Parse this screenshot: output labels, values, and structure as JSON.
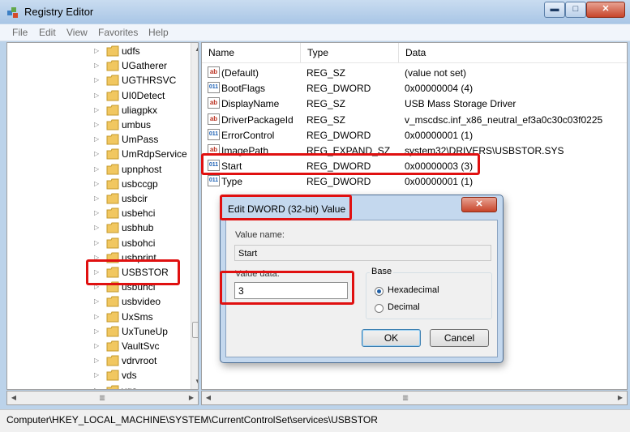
{
  "window": {
    "title": "Registry Editor",
    "minimize": "▬",
    "maximize": "□",
    "close": "✕"
  },
  "menu": [
    "File",
    "Edit",
    "View",
    "Favorites",
    "Help"
  ],
  "tree": {
    "items": [
      "udfs",
      "UGatherer",
      "UGTHRSVC",
      "UI0Detect",
      "uliagpkx",
      "umbus",
      "UmPass",
      "UmRdpService",
      "upnphost",
      "usbccgp",
      "usbcir",
      "usbehci",
      "usbhub",
      "usbohci",
      "usbprint",
      "USBSTOR",
      "usbuhci",
      "usbvideo",
      "UxSms",
      "UxTuneUp",
      "VaultSvc",
      "vdrvroot",
      "vds",
      "vga"
    ],
    "selected": "USBSTOR"
  },
  "list": {
    "columns": [
      "Name",
      "Type",
      "Data"
    ],
    "rows": [
      {
        "name": "(Default)",
        "type": "REG_SZ",
        "data": "(value not set)",
        "icon": "string-value-icon"
      },
      {
        "name": "BootFlags",
        "type": "REG_DWORD",
        "data": "0x00000004 (4)",
        "icon": "binary-value-icon"
      },
      {
        "name": "DisplayName",
        "type": "REG_SZ",
        "data": "USB Mass Storage Driver",
        "icon": "string-value-icon"
      },
      {
        "name": "DriverPackageId",
        "type": "REG_SZ",
        "data": "v_mscdsc.inf_x86_neutral_ef3a0c30c03f0225",
        "icon": "string-value-icon"
      },
      {
        "name": "ErrorControl",
        "type": "REG_DWORD",
        "data": "0x00000001 (1)",
        "icon": "binary-value-icon"
      },
      {
        "name": "ImagePath",
        "type": "REG_EXPAND_SZ",
        "data": "system32\\DRIVERS\\USBSTOR.SYS",
        "icon": "string-value-icon"
      },
      {
        "name": "Start",
        "type": "REG_DWORD",
        "data": "0x00000003 (3)",
        "icon": "binary-value-icon"
      },
      {
        "name": "Type",
        "type": "REG_DWORD",
        "data": "0x00000001 (1)",
        "icon": "binary-value-icon"
      }
    ]
  },
  "dialog": {
    "title": "Edit DWORD (32-bit) Value",
    "close": "✕",
    "value_name_label": "Value name:",
    "value_name": "Start",
    "value_data_label": "Value data:",
    "value_data": "3",
    "base_label": "Base",
    "base_options": [
      "Hexadecimal",
      "Decimal"
    ],
    "base_selected": "Hexadecimal",
    "ok": "OK",
    "cancel": "Cancel"
  },
  "status": {
    "path": "Computer\\HKEY_LOCAL_MACHINE\\SYSTEM\\CurrentControlSet\\services\\USBSTOR"
  },
  "colors": {
    "highlight": "#e01010",
    "window_frame": "#bcd3ea"
  }
}
